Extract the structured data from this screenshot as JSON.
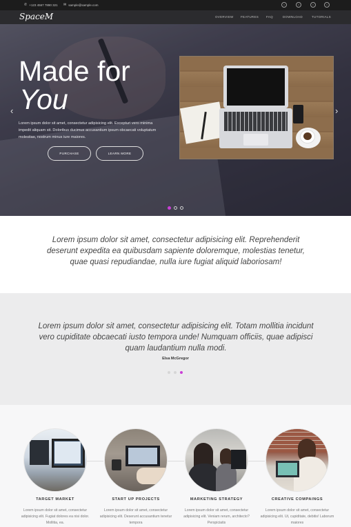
{
  "topbar": {
    "phone_icon": "phone-icon",
    "phone": "+123 4567 7890 321",
    "mail_icon": "envelope-icon",
    "email": "sample@sample.com",
    "social_icons": [
      "social-icon-1",
      "social-icon-2",
      "social-icon-3",
      "social-icon-4"
    ]
  },
  "navbar": {
    "brand": "SpaceM",
    "items": [
      "OVERVIEW",
      "FEATURES",
      "FAQ",
      "DOWNLOAD",
      "TUTORIALS"
    ]
  },
  "hero": {
    "title_line1": "Made for",
    "title_line2": "You",
    "text": "Lorem ipsum dolor sit amet, consectetur adipisicing elit. Excepturi vero minima impedit aliquam sit. Doloribus ducimus accusantium ipsum obcaecati voluptatum molestias, nostrum minus iure maiores.",
    "purchase_label": "PURCHASE",
    "learn_more_label": "LEARN MORE",
    "prev_arrow": "‹",
    "next_arrow": "›",
    "slide_count": 3,
    "active_slide": 1,
    "accent_color": "#c93fd6"
  },
  "quote_section": {
    "text": "Lorem ipsum dolor sit amet, consectetur adipisicing elit. Reprehenderit deserunt expedita ea quibusdam sapiente doloremque, molestias tenetur, quae quasi repudiandae, nulla iure fugiat aliquid laboriosam!"
  },
  "testimonial": {
    "text": "Lorem ipsum dolor sit amet, consectetur adipisicing elit. Totam mollitia incidunt vero cupiditate obcaecati iusto tempora unde! Numquam officiis, quae adipisci quam laudantium nulla modi.",
    "author": "Elsa McGregor",
    "active_dot": 3,
    "dot_count": 3
  },
  "features": [
    {
      "title": "TARGET MARKET",
      "text": "Lorem ipsum dolor sit amet, consectetur adipisicing elit. Fugiat dolores ea nisi dolor. Mollitia, ea."
    },
    {
      "title": "START UP PROJECTS",
      "text": "Lorem ipsum dolor sit amet, consectetur adipisicing elit. Deserunt accusantium tenetur tempora"
    },
    {
      "title": "MARKETING STRATEGY",
      "text": "Lorem ipsum dolor sit amet, consectetur adipisicing elit. Veniam rerum, architecto? Perspiciatis"
    },
    {
      "title": "CREATIVE COMPAINGS",
      "text": "Lorem ipsum dolor sit amet, consectetur adipisicing elit. Ut, cupiditate, debitis! Laborum maiores"
    }
  ]
}
